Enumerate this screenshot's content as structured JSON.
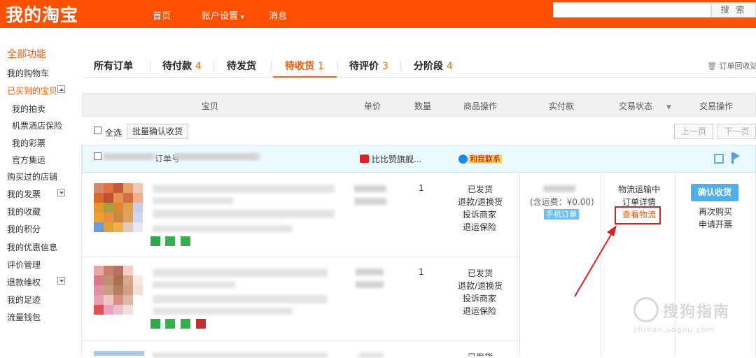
{
  "header": {
    "logo": "我的淘宝",
    "nav": [
      "首页",
      "账户设置",
      "消息"
    ],
    "search_button": "搜 索"
  },
  "sidebar": {
    "all_functions": "全部功能",
    "items": [
      {
        "label": "我的购物车"
      },
      {
        "label": "已买到的宝贝",
        "active": true
      },
      {
        "label": "我的拍卖",
        "sub": true
      },
      {
        "label": "机票酒店保险",
        "sub": true
      },
      {
        "label": "我的彩票",
        "sub": true
      },
      {
        "label": "官方集运",
        "sub": true
      },
      {
        "label": "购买过的店铺"
      },
      {
        "label": "我的发票"
      },
      {
        "label": "我的收藏"
      },
      {
        "label": "我的积分"
      },
      {
        "label": "我的优惠信息"
      },
      {
        "label": "评价管理"
      },
      {
        "label": "退款维权"
      },
      {
        "label": "我的足迹"
      },
      {
        "label": "流量钱包"
      }
    ]
  },
  "tabs": [
    {
      "label": "所有订单",
      "count": ""
    },
    {
      "label": "待付款",
      "count": "4"
    },
    {
      "label": "待发货",
      "count": ""
    },
    {
      "label": "待收货",
      "count": "1",
      "active": true
    },
    {
      "label": "待评价",
      "count": "3"
    },
    {
      "label": "分阶段",
      "count": "4"
    }
  ],
  "order_recycle": "订单回收站",
  "columns": [
    "宝贝",
    "单价",
    "数量",
    "商品操作",
    "实付款",
    "交易状态",
    "交易操作"
  ],
  "toolbar": {
    "select_all": "全选",
    "batch_confirm": "批量确认收货",
    "prev_page": "上一页",
    "next_page": "下一页"
  },
  "order": {
    "order_no_label": "订单号",
    "shop_name": "比比赞旗舰...",
    "contact": "和我联系",
    "items": [
      {
        "quantity": "1",
        "actions": [
          "已发货",
          "退款/退换货",
          "投诉商家",
          "退运保险"
        ]
      },
      {
        "quantity": "1",
        "actions": [
          "已发货",
          "退款/退换货",
          "投诉商家",
          "退运保险"
        ]
      }
    ],
    "shipping_fee_note": "(含运费：¥0.00)",
    "mobile_order": "手机订单",
    "status": "物流运输中",
    "order_detail": "订单详情",
    "view_logistics": "查看物流",
    "confirm_receipt": "确认收货",
    "buy_again": "再次购买",
    "apply_invoice": "申请开票",
    "third_item_action": "已发货"
  },
  "watermark": {
    "text": "搜狗指南",
    "sub": "zhinan.sogou.com"
  },
  "colors": {
    "brand": "#ff4f00",
    "accent": "#ff6a00",
    "highlight_box": "#e0201b",
    "confirm_button": "#4fb0e8"
  }
}
